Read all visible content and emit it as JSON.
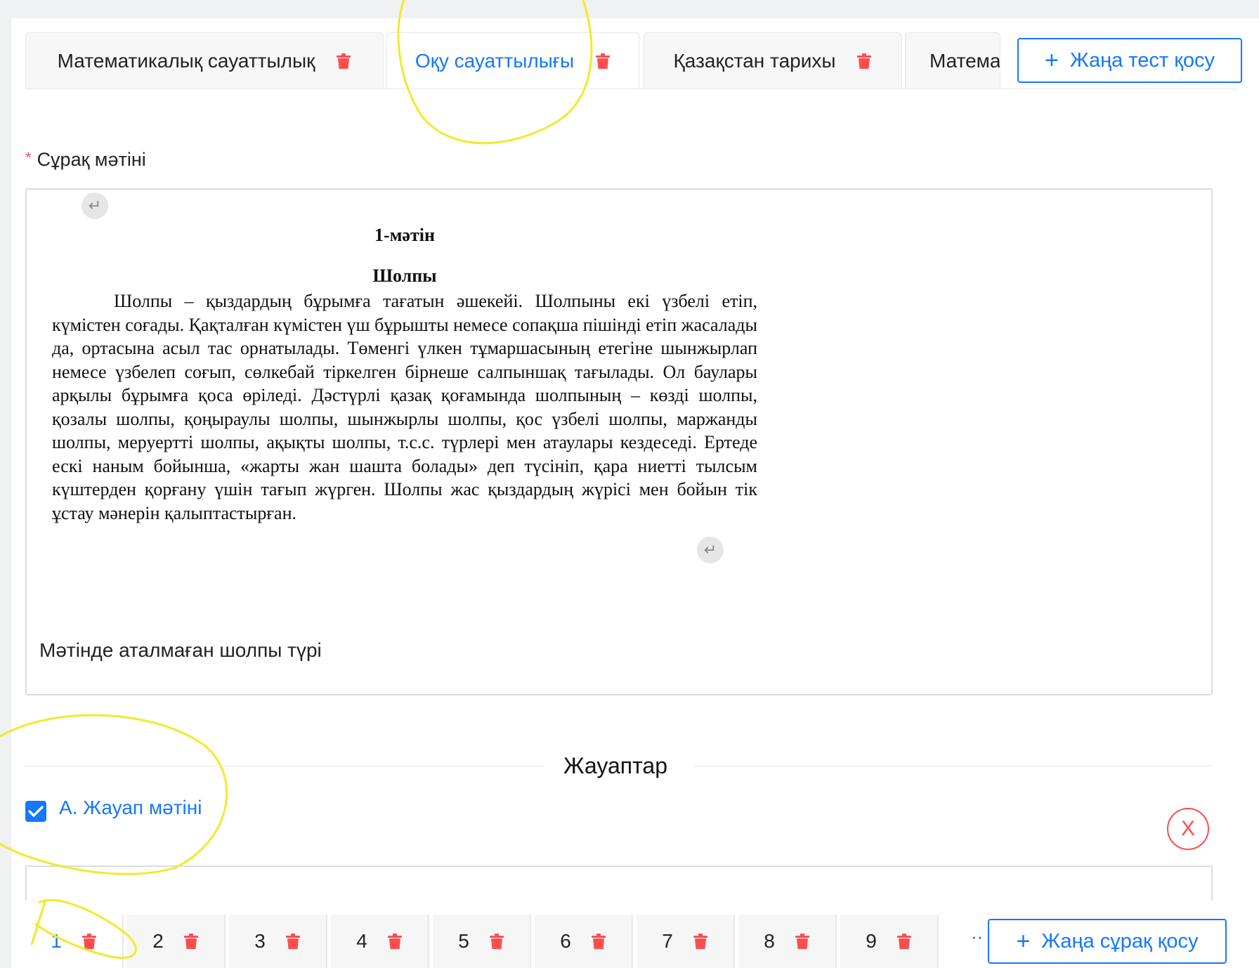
{
  "test_tabs": [
    {
      "label": "Математикалық сауаттылық",
      "icon": "trash-icon"
    },
    {
      "label": "Оқу сауаттылығы",
      "icon": "trash-icon",
      "active": true
    },
    {
      "label": "Қазақстан тарихы",
      "icon": "trash-icon"
    },
    {
      "label": "Матема",
      "icon": "trash-icon"
    }
  ],
  "add_test_button": {
    "label": "Жаңа тест қосу",
    "icon": "plus-icon"
  },
  "question_field": {
    "required_mark": "*",
    "label": "Сұрақ мәтіні"
  },
  "document": {
    "title": "1-мәтін",
    "subtitle": "Шолпы",
    "body": "Шолпы – қыздардың бұрымға тағатын әшекейі. Шолпыны екі үзбелі етіп, күмістен соғады. Қақталған күмістен үш бұрышты немесе сопақша пішінді етіп жасалады да, ортасына асыл тас орнатылады. Төменгі үлкен тұмаршасының етегіне шынжырлап немесе үзбелеп соғып, сөлкебай тіркелген бірнеше салпыншақ тағылады. Ол баулары арқылы бұрымға қоса өріледі. Дәстүрлі қазақ қоғамында шолпының – көзді шолпы, қозалы шолпы, қоңыраулы шолпы, шынжырлы шолпы, қос үзбелі шолпы, маржанды шолпы, меруертті шолпы, ақықты шолпы, т.с.с. түрлері мен атаулары кездеседі. Ертеде ескі наным бойынша, «жарты жан шашта болады» деп түсініп, қара ниетті тылсым күштерден қорғану үшін тағып жүрген. Шолпы жас қыздардың жүрісі мен бойын тік ұстау мәнерін қалыптастырған."
  },
  "question_text": "Мәтінде аталмаған шолпы түрі",
  "answers_section": {
    "title": "Жауаптар"
  },
  "answer": {
    "label": "А. Жауап мәтіні",
    "checked": true,
    "remove_symbol": "X"
  },
  "question_tabs": [
    "1",
    "2",
    "3",
    "4",
    "5",
    "6",
    "7",
    "8",
    "9"
  ],
  "question_tabs_overflow": "··",
  "add_question_button": {
    "label": "Жаңа сұрақ қосу",
    "icon": "plus-icon"
  },
  "colors": {
    "accent": "#1677ff",
    "danger": "#ff4d4f",
    "highlight": "#f2ea2a"
  }
}
